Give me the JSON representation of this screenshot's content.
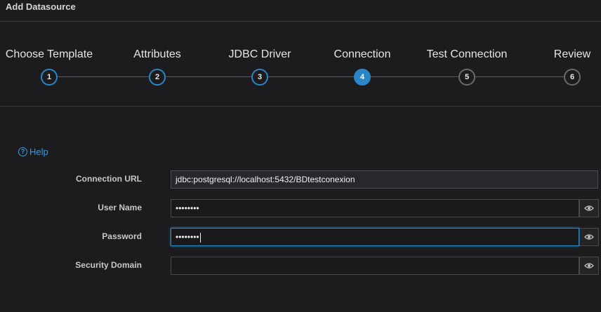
{
  "header": {
    "title": "Add Datasource"
  },
  "wizard": {
    "steps": [
      {
        "label": "Choose Template",
        "number": "1",
        "state": "done"
      },
      {
        "label": "Attributes",
        "number": "2",
        "state": "done"
      },
      {
        "label": "JDBC Driver",
        "number": "3",
        "state": "done"
      },
      {
        "label": "Connection",
        "number": "4",
        "state": "active"
      },
      {
        "label": "Test Connection",
        "number": "5",
        "state": "future"
      },
      {
        "label": "Review",
        "number": "6",
        "state": "future"
      }
    ]
  },
  "help": {
    "label": "Help",
    "icon": "question-circle-icon"
  },
  "form": {
    "connection_url": {
      "label": "Connection URL",
      "value": "jdbc:postgresql://localhost:5432/BDtestconexion"
    },
    "user_name": {
      "label": "User Name",
      "value": "••••••••",
      "reveal_icon": "eye-icon"
    },
    "password": {
      "label": "Password",
      "value": "••••••••",
      "reveal_icon": "eye-icon"
    },
    "security_domain": {
      "label": "Security Domain",
      "value": "",
      "reveal_icon": "eye-icon"
    }
  },
  "colors": {
    "accent": "#2a86c4",
    "background": "#1c1c1e",
    "link": "#3d9ad6"
  }
}
